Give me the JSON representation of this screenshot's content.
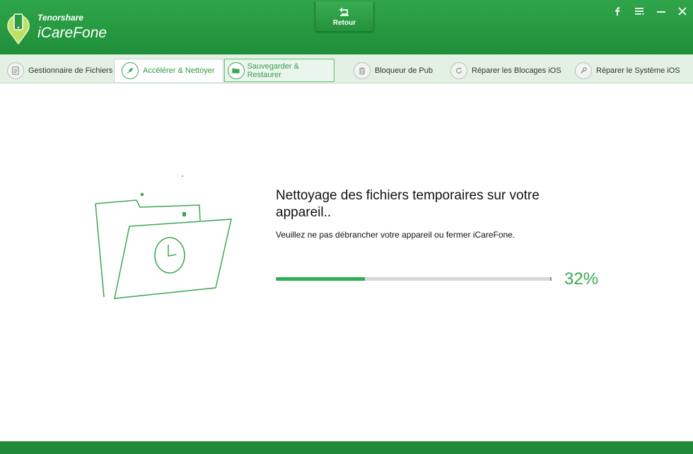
{
  "app": {
    "brand_company": "Tenorshare",
    "brand_product": "iCareFone",
    "back_label": "Retour"
  },
  "window_buttons": [
    "facebook-icon",
    "menu-icon",
    "minimize-icon",
    "close-icon"
  ],
  "tabs": [
    {
      "label": "Gestionnaire de Fichiers",
      "icon": "file-manager-icon",
      "state": "normal"
    },
    {
      "label": "Accélérer & Nettoyer",
      "icon": "rocket-icon",
      "state": "active"
    },
    {
      "label": "Sauvegarder & Restaurer",
      "icon": "folder-icon",
      "state": "hover"
    },
    {
      "label": "Bloqueur de Pub",
      "icon": "trash-icon",
      "state": "normal"
    },
    {
      "label": "Réparer les Blocages iOS",
      "icon": "refresh-icon",
      "state": "normal"
    },
    {
      "label": "Réparer le Système iOS",
      "icon": "wrench-icon",
      "state": "normal"
    }
  ],
  "main": {
    "title": "Nettoyage des fichiers temporaires sur votre appareil..",
    "subtitle": "Veuillez ne pas débrancher votre appareil ou fermer iCareFone.",
    "progress_value": 0.32,
    "progress_text": "32%"
  },
  "colors": {
    "brand_green": "#1f8f3a",
    "accent_green": "#3aa851",
    "progress_fill": "#2bb24c"
  }
}
